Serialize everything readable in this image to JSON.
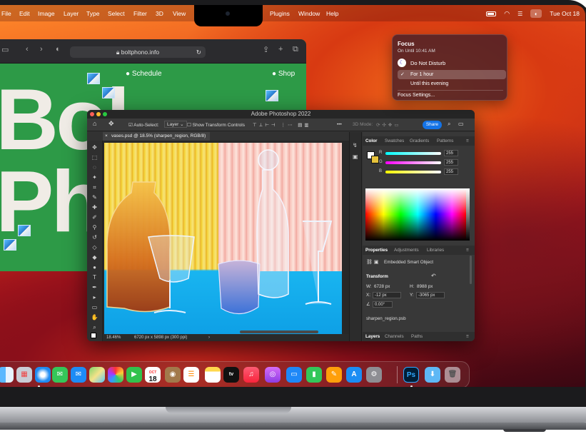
{
  "menubar": {
    "items": [
      "File",
      "Edit",
      "Image",
      "Layer",
      "Type",
      "Select",
      "Filter",
      "3D",
      "View",
      "Plugins",
      "Window",
      "Help"
    ],
    "clock": "Tue Oct 18"
  },
  "focus": {
    "title": "Focus",
    "subtitle": "On Until 10:41 AM",
    "mode": "Do Not Disturb",
    "options": [
      "For 1 hour",
      "Until this evening"
    ],
    "selected_check": "✓",
    "settings": "Focus Settings..."
  },
  "browser": {
    "url": "boltphono.info",
    "nav": [
      "Schedule",
      "Shop"
    ],
    "hero_line1": "Bo",
    "hero_line2": "Ph",
    "hero_cursor": "l"
  },
  "photoshop": {
    "title": "Adobe Photoshop 2022",
    "options": {
      "auto_select": "Auto-Select:",
      "layer": "Layer",
      "transform_controls": "Show Transform Controls",
      "mode_3d": "3D Mode:",
      "share": "Share"
    },
    "doc_tab": "vases.psd @ 18.5% (sharpen_region, RGB/8)",
    "status": {
      "zoom": "18.46%",
      "size": "6720 px x 5898 px (300 ppi)"
    },
    "color_panel": {
      "tabs": [
        "Color",
        "Swatches",
        "Gradients",
        "Patterns"
      ],
      "channels": [
        {
          "label": "R",
          "value": "255"
        },
        {
          "label": "G",
          "value": "255"
        },
        {
          "label": "B",
          "value": "255"
        }
      ]
    },
    "properties_panel": {
      "tabs": [
        "Properties",
        "Adjustments",
        "Libraries"
      ],
      "object_type": "Embedded Smart Object",
      "section": "Transform",
      "w_label": "W:",
      "w": "6728 px",
      "h_label": "H:",
      "h": "8988 px",
      "x_label": "X:",
      "x": "-12 px",
      "y_label": "Y:",
      "y": "-3065 px",
      "angle": "0.00°",
      "filename": "sharpen_region.psb"
    },
    "layers_panel": {
      "tabs": [
        "Layers",
        "Channels",
        "Paths"
      ]
    }
  },
  "dock": {
    "calendar_month": "OCT",
    "calendar_day": "18",
    "tv_label": "tv",
    "ps_label": "Ps",
    "apps": [
      "finder",
      "launchpad",
      "safari",
      "messages",
      "mail",
      "maps",
      "photos",
      "facetime",
      "calendar",
      "contacts",
      "reminders",
      "notes",
      "tv",
      "music",
      "podcasts",
      "keynote",
      "numbers",
      "pages",
      "app-store",
      "system-preferences",
      "photoshop",
      "downloads",
      "trash"
    ]
  },
  "colors": {
    "accent_blue": "#1473e6",
    "browser_green": "#2d9a47",
    "focus_purple": "#5b3fd9"
  }
}
